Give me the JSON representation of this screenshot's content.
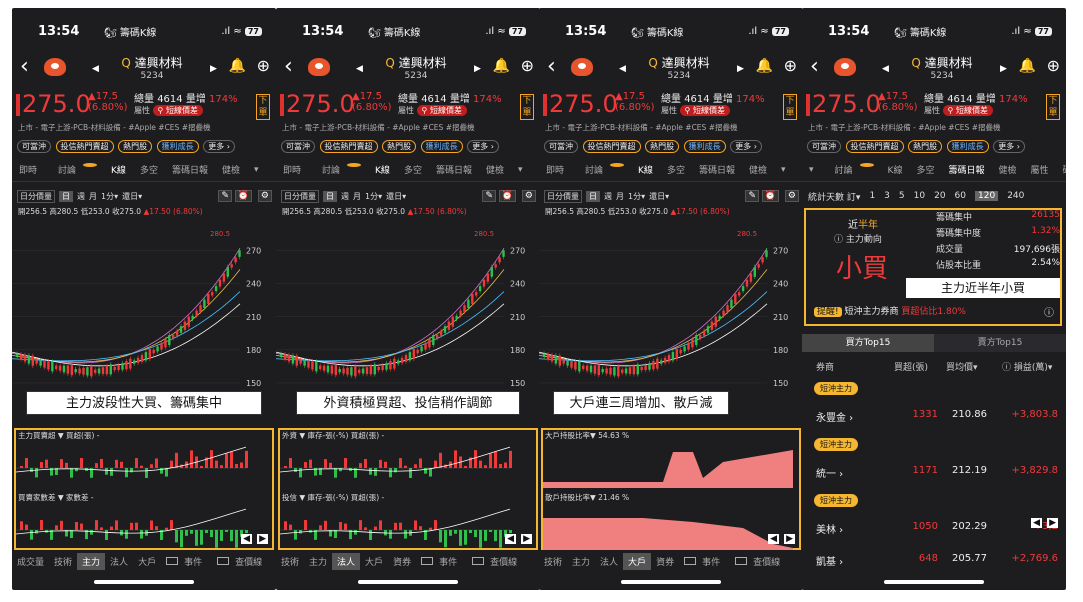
{
  "status": {
    "time": "13:54",
    "app": "籌碼K線",
    "battery": "77"
  },
  "stock": {
    "name": "達興材料",
    "code": "5234",
    "price": "275.0",
    "change": "▲17.5",
    "pct": "(6.80%)",
    "volume_label": "總量",
    "volume": "4614",
    "ratio_label": "量增",
    "ratio": "174%",
    "attr_label": "屬性",
    "attr_tag": "短線價差",
    "xia": "下單"
  },
  "tags_line": "上市 - 電子上游-PCB-材料設備 - #Apple #CES #摺疊機",
  "pills": [
    "可當沖",
    "投信熱門賣超",
    "熱門股",
    "獲利成長",
    "更多 ›"
  ],
  "tabs": [
    "即時",
    "討論",
    "K線",
    "多空",
    "籌碼日報",
    "健檢"
  ],
  "tabs4": [
    "討論",
    "K線",
    "多空",
    "籌碼日報",
    "健檢",
    "屬性",
    "研"
  ],
  "ctl": {
    "period": "日分價量",
    "d": "日",
    "w": "週",
    "m": "月",
    "min": "1分",
    "type": "還日"
  },
  "ohlc": {
    "text": "開256.5 高280.5 低253.0 收275.0",
    "chg": "▲17.50 (6.80%)"
  },
  "axis": [
    "270",
    "240",
    "210",
    "180",
    "150"
  ],
  "peak": "280.5",
  "banners": [
    "主力波段性大買、籌碼集中",
    "外資積極買超、投信稍作調節",
    "大戶連三周增加、散戶減"
  ],
  "sub1": {
    "h1": "主力買賣超 ▼ 買超(張) -",
    "h2": "買賣家數差 ▼ 家數差 -"
  },
  "sub2": {
    "h1": "外資 ▼ 庫存-張(-%) 買超(張) -",
    "h2": "投信 ▼ 庫存-張(-%) 買超(張) -"
  },
  "sub3": {
    "h1": "大戶持股比率▼ 54.63 %",
    "h2": "散戶持股比率▼ 21.46 %"
  },
  "bottom1": [
    "成交量",
    "技術",
    "主力",
    "法人",
    "大戶"
  ],
  "bottom2": [
    "技術",
    "主力",
    "法人",
    "大戶",
    "資券"
  ],
  "bottom3": [
    "技術",
    "主力",
    "法人",
    "大戶",
    "資券"
  ],
  "checks": [
    "事件",
    "查價線"
  ],
  "days": {
    "label": "統計天數",
    "sub": "訂",
    "opts": [
      "1",
      "3",
      "5",
      "10",
      "20",
      "60",
      "120",
      "240"
    ],
    "active": "120"
  },
  "summary": {
    "period_a": "近",
    "period_b": "半年",
    "flow": "ⓘ 主力動向",
    "big": "小買",
    "k1": "籌碼集中",
    "v1": "26135",
    "k2": "籌碼集中度",
    "v2": "1.32%",
    "k3": "成交量",
    "v3": "197,696張",
    "k4": "佔股本比重",
    "v4": "2.54%",
    "box": "主力近半年小買",
    "alert_tag": "提醒!",
    "alert": "短沖主力券商",
    "alert_r": "買超佔比1.80%"
  },
  "top15": [
    "買方Top15",
    "賣方Top15"
  ],
  "thead": [
    "券商",
    "買超(張)",
    "買均價▾",
    "ⓘ 損益(萬)▾"
  ],
  "rows": [
    {
      "tag": "短沖主力",
      "name": "永豐金 ›",
      "qty": "1331",
      "avg": "210.86",
      "pnl": "+3,803.8"
    },
    {
      "tag": "短沖主力",
      "name": "統一 ›",
      "qty": "1171",
      "avg": "212.19",
      "pnl": "+3,829.8"
    },
    {
      "tag": "短沖主力",
      "name": "美林 ›",
      "qty": "1050",
      "avg": "202.29",
      "pnl": "+3,2"
    },
    {
      "tag": "",
      "name": "凱基 ›",
      "qty": "648",
      "avg": "205.77",
      "pnl": "+2,769.6"
    }
  ]
}
